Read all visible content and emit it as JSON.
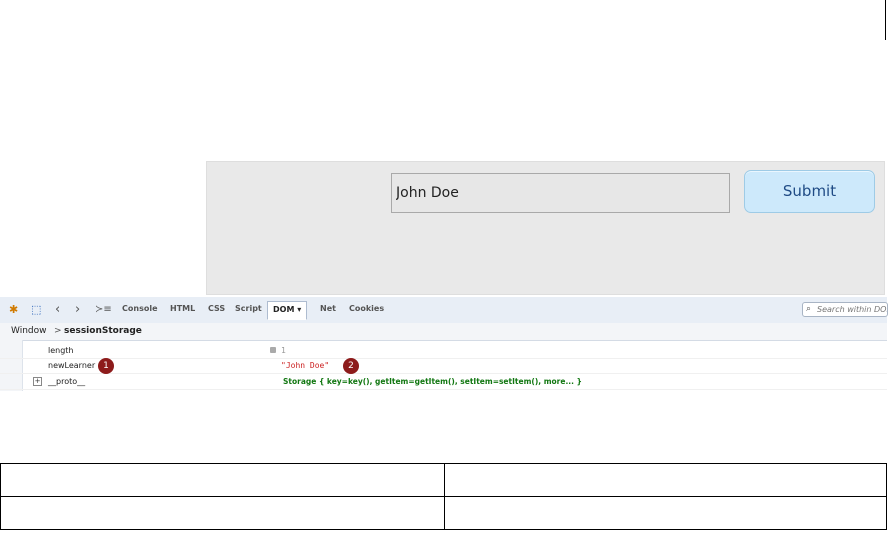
{
  "form": {
    "name_value": "John Doe",
    "submit_label": "Submit"
  },
  "devtools": {
    "tabs": [
      {
        "label": "Console",
        "active": false
      },
      {
        "label": "HTML",
        "active": false
      },
      {
        "label": "CSS",
        "active": false
      },
      {
        "label": "Script",
        "active": false
      },
      {
        "label": "DOM",
        "active": true
      },
      {
        "label": "Net",
        "active": false
      },
      {
        "label": "Cookies",
        "active": false
      }
    ],
    "dom_dropdown_arrow": "▾",
    "search_placeholder": "Search within DOM",
    "breadcrumb": {
      "root": "Window",
      "separator": ">",
      "current": "sessionStorage"
    },
    "rows": [
      {
        "key": "length",
        "value": "1",
        "value_color": "#999999"
      },
      {
        "key": "newLearner",
        "value": "\"John Doe\"",
        "value_color": "#cc2222"
      },
      {
        "key": "__proto__",
        "value": "Storage { key=key(),  getItem=getItem(),  setItem=setItem(),  more... }",
        "value_color": "#117711",
        "expandable": true
      }
    ],
    "callouts": [
      "1",
      "2"
    ],
    "expand_symbol": "+"
  },
  "colors": {
    "badge": "#8d1b1b",
    "submit_bg": "#cde9fb",
    "toolbar_bg": "#e8eef6"
  }
}
